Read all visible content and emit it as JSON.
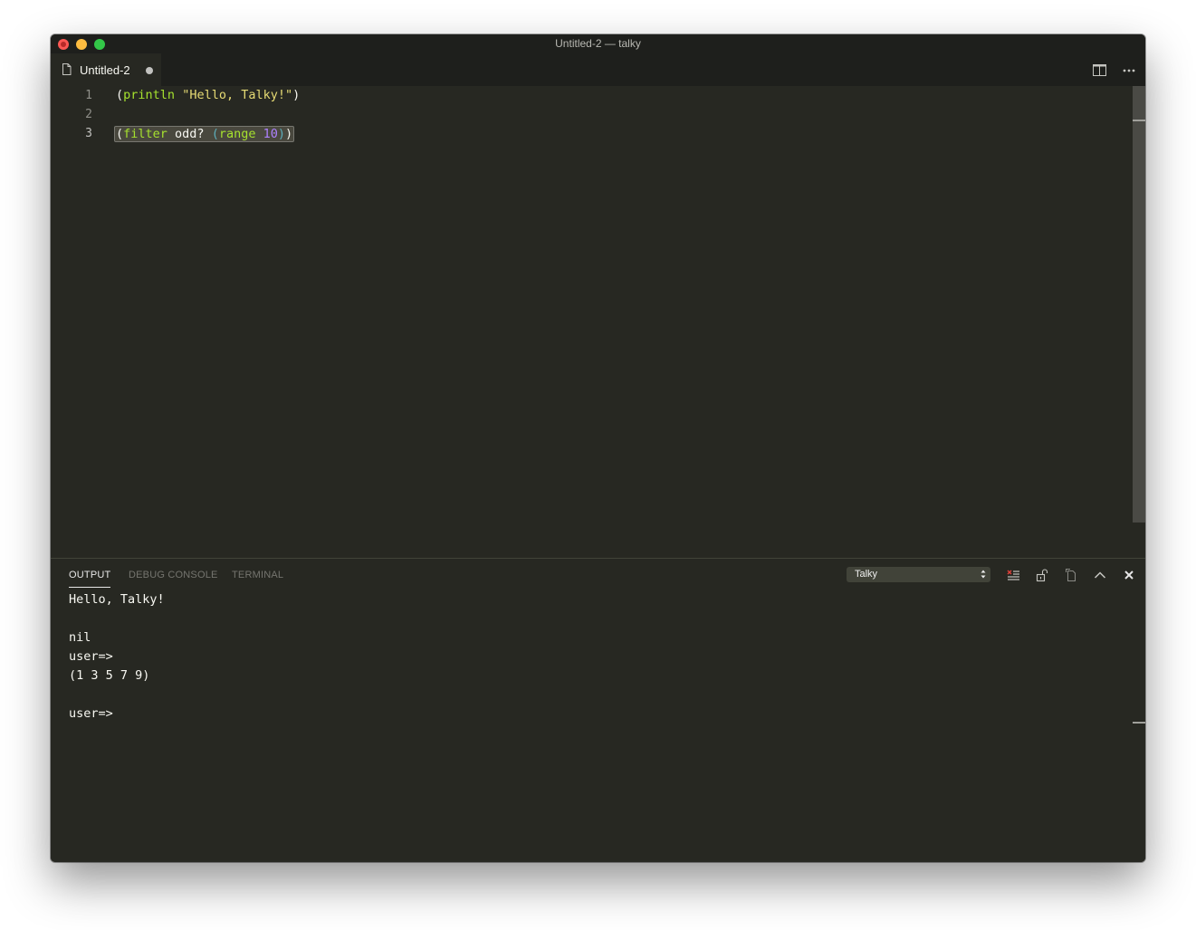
{
  "window": {
    "title": "Untitled-2 — talky"
  },
  "tab": {
    "label": "Untitled-2",
    "icon": "file-icon",
    "dirty": true
  },
  "editor_actions": {
    "split_icon": "split-editor-icon",
    "more_icon": "more-actions-icon"
  },
  "editor": {
    "line_numbers": [
      "1",
      "2",
      "3"
    ],
    "lines": [
      {
        "open": "(",
        "fn": "println",
        "sp": " ",
        "str": "\"Hello, Talky!\"",
        "close": ")"
      },
      {},
      {
        "open": "(",
        "fn": "filter",
        "sym": " odd? ",
        "inner_open": "(",
        "inner_fn": "range",
        "sp": " ",
        "num": "10",
        "inner_close": ")",
        "close": ")"
      }
    ]
  },
  "panel": {
    "tabs": {
      "output": "OUTPUT",
      "debug_console": "DEBUG CONSOLE",
      "terminal": "TERMINAL"
    },
    "channel_select": "Talky",
    "output_lines": [
      "Hello, Talky!",
      "",
      "nil",
      "user=>",
      "(1 3 5 7 9)",
      "",
      "user=>"
    ],
    "icons": {
      "clear": "clear-output-icon",
      "lock": "scroll-lock-icon",
      "copy": "open-log-icon",
      "maximize": "chevron-up-icon",
      "close": "close-icon"
    }
  },
  "colors": {
    "editor_background": "#272822",
    "title_background": "#1e1f1c",
    "function": "#a6e22e",
    "string": "#e6db74",
    "number": "#ae81ff",
    "text": "#f8f8f2",
    "clear_icon_accent": "#e2413a"
  }
}
